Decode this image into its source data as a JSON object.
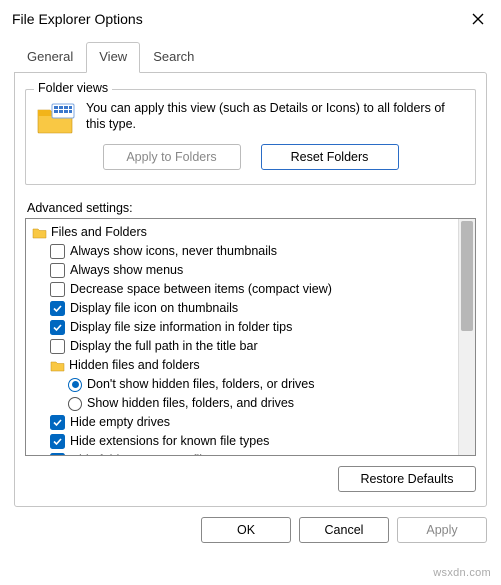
{
  "title": "File Explorer Options",
  "tabs": {
    "general": "General",
    "view": "View",
    "search": "Search"
  },
  "folderViews": {
    "groupLabel": "Folder views",
    "text": "You can apply this view (such as Details or Icons) to all folders of this type.",
    "applyBtn": "Apply to Folders",
    "resetBtn": "Reset Folders"
  },
  "advLabel": "Advanced settings:",
  "tree": {
    "root": "Files and Folders",
    "items": [
      "Always show icons, never thumbnails",
      "Always show menus",
      "Decrease space between items (compact view)",
      "Display file icon on thumbnails",
      "Display file size information in folder tips",
      "Display the full path in the title bar"
    ],
    "hiddenGroup": "Hidden files and folders",
    "radios": [
      "Don't show hidden files, folders, or drives",
      "Show hidden files, folders, and drives"
    ],
    "tail": [
      "Hide empty drives",
      "Hide extensions for known file types",
      "Hide folder merge conflicts"
    ]
  },
  "restoreBtn": "Restore Defaults",
  "bottom": {
    "ok": "OK",
    "cancel": "Cancel",
    "apply": "Apply"
  },
  "watermark": "wsxdn.com"
}
